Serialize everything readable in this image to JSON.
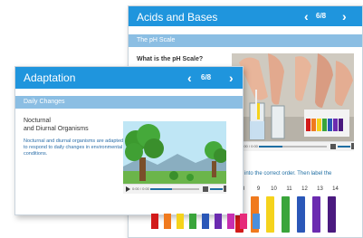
{
  "back_card": {
    "title": "Acids and Bases",
    "pager": "6/8",
    "prev_icon": "chevron-left-icon",
    "next_icon": "chevron-right-icon",
    "section": "The pH Scale",
    "question": "What is the pH Scale?",
    "player": {
      "time": "0:00 / 0:00",
      "progress": 0.35
    },
    "instruction": "into the correct order. Then label the",
    "ph_numbers": [
      "8",
      "9",
      "10",
      "11",
      "12",
      "13",
      "14"
    ],
    "strip_colors": [
      "#d21a1a",
      "#f07a1e",
      "#f5d31c",
      "#3aa53b",
      "#2a57b8",
      "#6b2bb0",
      "#4a1a7f"
    ]
  },
  "front_card": {
    "title": "Adaptation",
    "pager": "6/8",
    "prev_icon": "chevron-left-icon",
    "next_icon": "chevron-right-icon",
    "section": "Daily Changes",
    "heading_line1": "Nocturnal",
    "heading_line2": "and Diurnal Organisms",
    "description": "Nocturnal and diurnal organisms are adapted to respond to daily changes in environmental conditions.",
    "player": {
      "time": "0:00 / 0:00",
      "progress": 0.45
    },
    "bottom_strip_colors": [
      "#d21a1a",
      "#f07a1e",
      "#f5d31c",
      "#3aa53b",
      "#2a57b8",
      "#6b2bb0",
      "#c72fb0",
      "#e62b7a",
      "#4a8fdc"
    ]
  }
}
